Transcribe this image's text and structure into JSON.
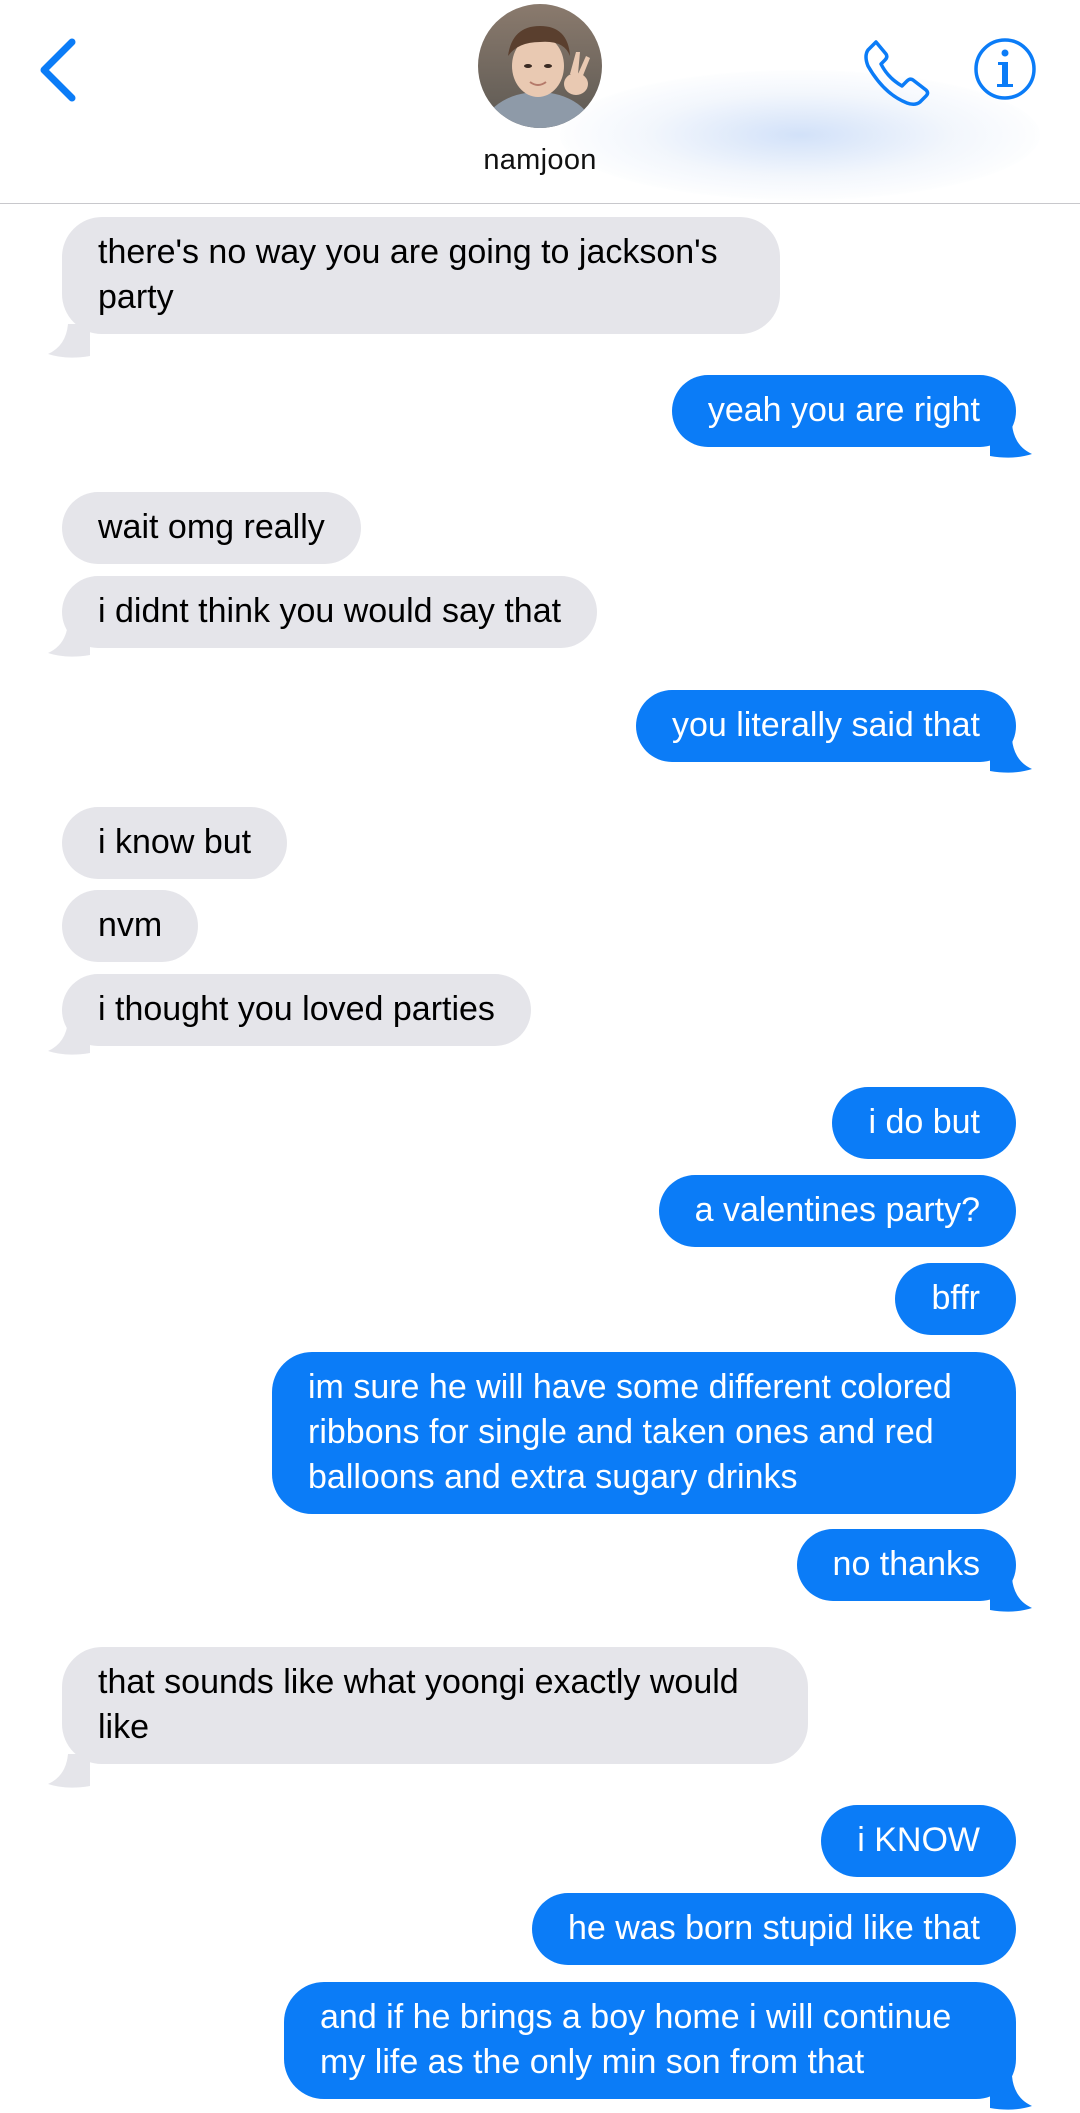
{
  "header": {
    "back_icon": "chevron-left-icon",
    "contact_name": "namjoon",
    "call_icon": "phone-icon",
    "info_icon": "info-icon",
    "accent_color": "#0b7cf7"
  },
  "colors": {
    "incoming_bubble": "#e5e5ea",
    "outgoing_bubble": "#0b7cf7"
  },
  "messages": [
    {
      "dir": "in",
      "text": "there's no way you are going to jackson's\nparty",
      "tail": true
    },
    {
      "dir": "out",
      "text": "yeah you are right",
      "tail": true
    },
    {
      "dir": "in",
      "text": "wait omg really",
      "tail": false
    },
    {
      "dir": "in",
      "text": "i didnt think you would say that",
      "tail": true
    },
    {
      "dir": "out",
      "text": "you literally said that",
      "tail": true
    },
    {
      "dir": "in",
      "text": "i know but",
      "tail": false
    },
    {
      "dir": "in",
      "text": "nvm",
      "tail": false
    },
    {
      "dir": "in",
      "text": "i thought you loved parties",
      "tail": true
    },
    {
      "dir": "out",
      "text": "i do but",
      "tail": false
    },
    {
      "dir": "out",
      "text": "a valentines party?",
      "tail": false
    },
    {
      "dir": "out",
      "text": "bffr",
      "tail": false
    },
    {
      "dir": "out",
      "text": "im sure he will have some different colored\nribbons for single and taken ones and red\nballoons and extra sugary drinks",
      "tail": false
    },
    {
      "dir": "out",
      "text": "no thanks",
      "tail": true
    },
    {
      "dir": "in",
      "text": "that sounds like what yoongi exactly would\nlike",
      "tail": true
    },
    {
      "dir": "out",
      "text": "i KNOW",
      "tail": false
    },
    {
      "dir": "out",
      "text": "he was born stupid like that",
      "tail": false
    },
    {
      "dir": "out",
      "text": "and if he brings a boy home i will continue\nmy life as the only min son from that",
      "tail": true
    }
  ]
}
